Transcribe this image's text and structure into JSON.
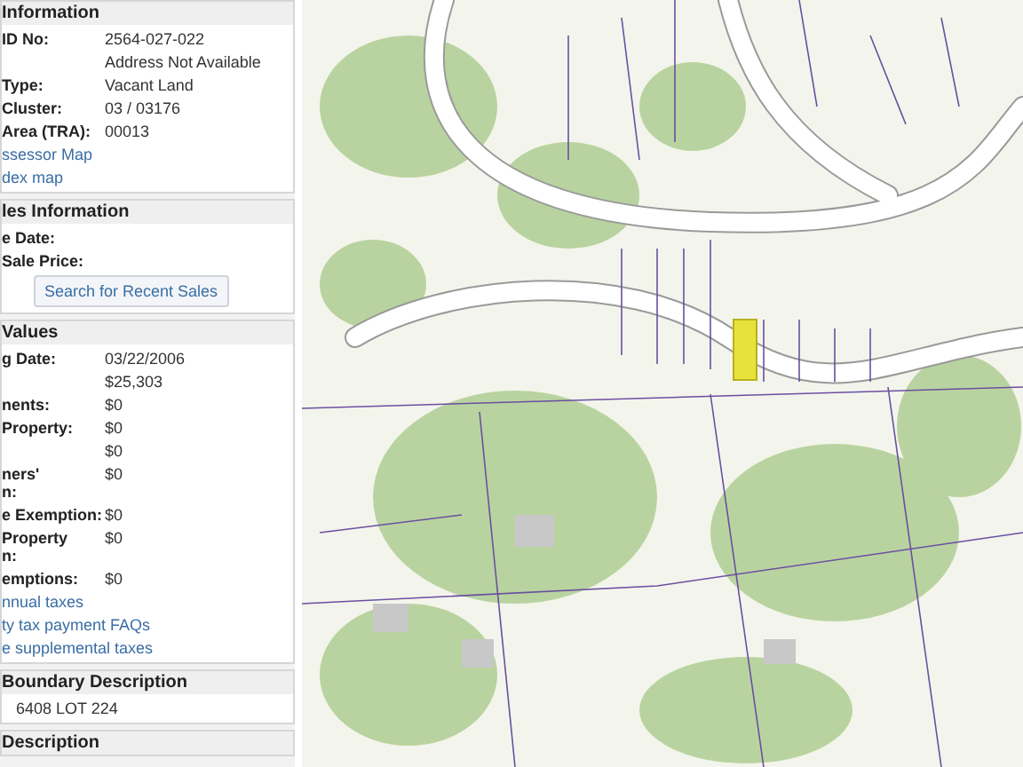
{
  "sections": [
    {
      "title": "Information",
      "rows": [
        {
          "label": "ID No:",
          "value": "2564-027-022"
        },
        {
          "label": "",
          "value": "Address Not Available"
        },
        {
          "label": "Type:",
          "value": "Vacant Land"
        },
        {
          "label": "Cluster:",
          "value": "03 / 03176"
        },
        {
          "label": "Area (TRA):",
          "value": "00013"
        }
      ],
      "links": [
        "ssessor Map",
        "dex map"
      ]
    },
    {
      "title": "les Information",
      "rows": [
        {
          "label": "e Date:",
          "value": ""
        },
        {
          "label": "Sale Price:",
          "value": ""
        }
      ],
      "button": "Search for Recent Sales"
    },
    {
      "title": "Values",
      "rows": [
        {
          "label": "g Date:",
          "value": "03/22/2006"
        },
        {
          "label": "",
          "value": "$25,303"
        },
        {
          "label": "nents:",
          "value": "$0"
        },
        {
          "label": "Property:",
          "value": "$0"
        },
        {
          "label": "",
          "value": "$0"
        },
        {
          "label": "ners'\nn:",
          "value": "$0"
        },
        {
          "label": "e Exemption:",
          "value": "$0"
        },
        {
          "label": "Property\nn:",
          "value": "$0"
        },
        {
          "label": "emptions:",
          "value": "$0"
        }
      ],
      "links": [
        "nnual taxes",
        "ty tax payment FAQs",
        "e supplemental taxes"
      ]
    },
    {
      "title": "Boundary Description",
      "text": "6408 LOT 224"
    },
    {
      "title": "Description"
    }
  ]
}
